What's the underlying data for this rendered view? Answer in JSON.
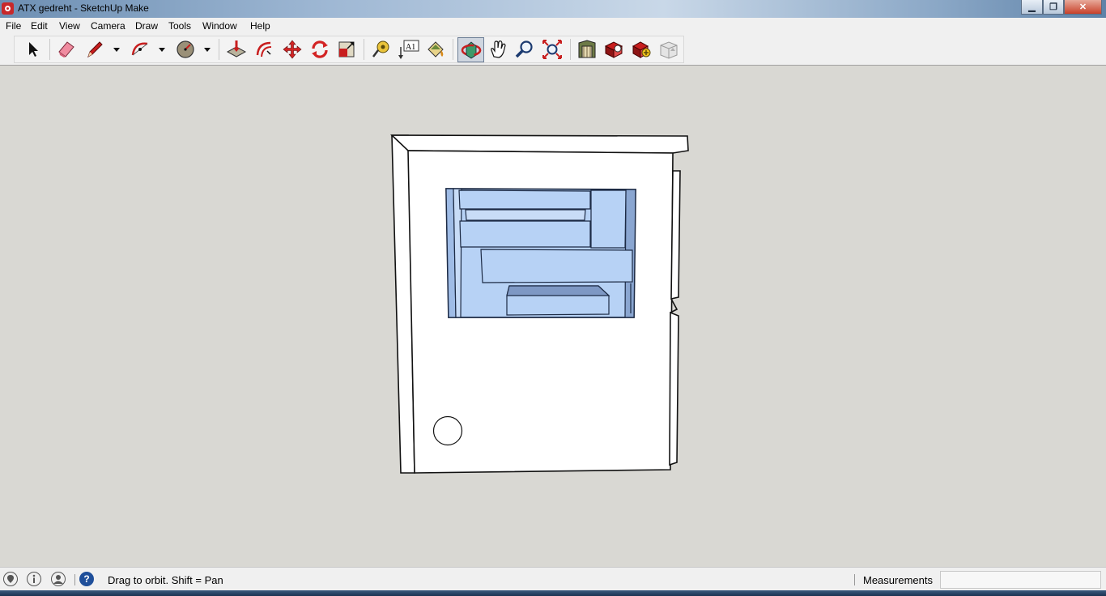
{
  "window": {
    "title": "ATX gedreht - SketchUp Make",
    "minimize_glyph": "▁",
    "maximize_glyph": "❐",
    "close_glyph": "✕"
  },
  "menu": [
    "File",
    "Edit",
    "View",
    "Camera",
    "Draw",
    "Tools",
    "Window",
    "Help"
  ],
  "toolbar": {
    "tools": [
      {
        "name": "select-tool",
        "icon": "arrow-cursor-icon"
      },
      {
        "name": "eraser-tool",
        "icon": "eraser-icon"
      },
      {
        "name": "line-tool",
        "icon": "pencil-icon"
      },
      {
        "name": "arc-tool",
        "icon": "arc-icon"
      },
      {
        "name": "shapes-tool",
        "icon": "circle-icon"
      },
      {
        "name": "push-pull-tool",
        "icon": "push-pull-icon"
      },
      {
        "name": "offset-tool",
        "icon": "offset-icon"
      },
      {
        "name": "move-tool",
        "icon": "move-arrows-icon"
      },
      {
        "name": "rotate-tool",
        "icon": "rotate-icon"
      },
      {
        "name": "scale-tool",
        "icon": "scale-icon"
      },
      {
        "name": "tape-measure-tool",
        "icon": "tape-measure-icon"
      },
      {
        "name": "text-tool",
        "icon": "text-label-icon"
      },
      {
        "name": "paint-bucket-tool",
        "icon": "paint-bucket-icon"
      },
      {
        "name": "orbit-tool",
        "icon": "orbit-icon",
        "active": true
      },
      {
        "name": "pan-tool",
        "icon": "hand-icon"
      },
      {
        "name": "zoom-tool",
        "icon": "magnifier-icon"
      },
      {
        "name": "zoom-extents-tool",
        "icon": "zoom-extents-icon"
      },
      {
        "name": "3d-warehouse",
        "icon": "warehouse-icon"
      },
      {
        "name": "share-model",
        "icon": "share-model-icon"
      },
      {
        "name": "get-components",
        "icon": "components-icon"
      },
      {
        "name": "extension-warehouse",
        "icon": "extension-icon"
      }
    ],
    "text_tool_label": "A1"
  },
  "status": {
    "hint": "Drag to orbit.  Shift = Pan",
    "measurements_label": "Measurements",
    "measurements_value": "",
    "help_glyph": "?"
  },
  "colors": {
    "viewport_background": "#d9d8d3",
    "model_face": "#ffffff",
    "glass_face": "#b7d2f5",
    "glass_shadow": "#7e98c4",
    "active_tool": "#cfd6e0"
  }
}
